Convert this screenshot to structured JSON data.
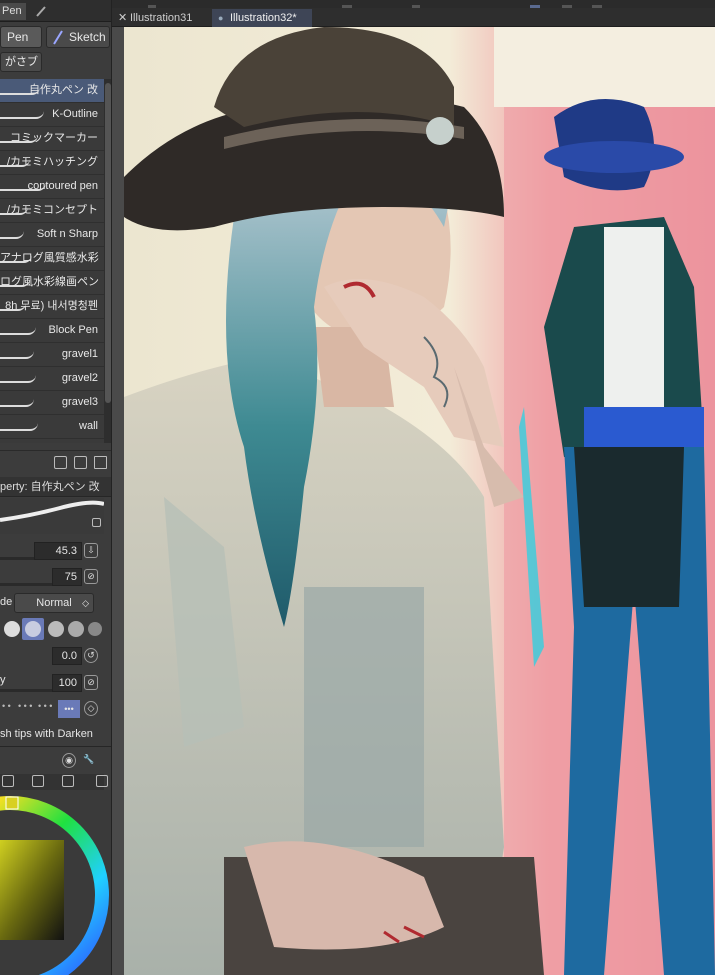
{
  "tool_panel": {
    "tab_label": "Pen",
    "subtools": [
      "Pen",
      "Sketch"
    ],
    "subtool_group": "がさブ"
  },
  "brushes": [
    {
      "label": "自作丸ペン 改",
      "selected": true
    },
    {
      "label": "K-Outline"
    },
    {
      "label": "コミックマーカー"
    },
    {
      "label": "/カモミハッチング"
    },
    {
      "label": "contoured pen"
    },
    {
      "label": "/カモミコンセプト"
    },
    {
      "label": "Soft n Sharp"
    },
    {
      "label": "アナログ風質感水彩"
    },
    {
      "label": "ログ風水彩線画ペン"
    },
    {
      "label": "8h 무료) 내서명청펜"
    },
    {
      "label": "Block Pen"
    },
    {
      "label": "gravel1"
    },
    {
      "label": "gravel2"
    },
    {
      "label": "gravel3"
    },
    {
      "label": "wall"
    }
  ],
  "properties": {
    "header": "perty: 自作丸ペン 改",
    "brush_size": "45.3",
    "opacity": "75",
    "blend_mode_label": "de",
    "blend_mode": "Normal",
    "value_00": "0.0",
    "value_100": "100",
    "density_label": "y",
    "footer_text": "sh tips with Darken"
  },
  "documents": [
    {
      "label": "Illustration31",
      "active": false
    },
    {
      "label": "Illustration32*",
      "active": true
    }
  ],
  "colors": {
    "accent": "#4a5a78",
    "panel": "#3c3c3c",
    "selected_color": "#d8d020"
  }
}
